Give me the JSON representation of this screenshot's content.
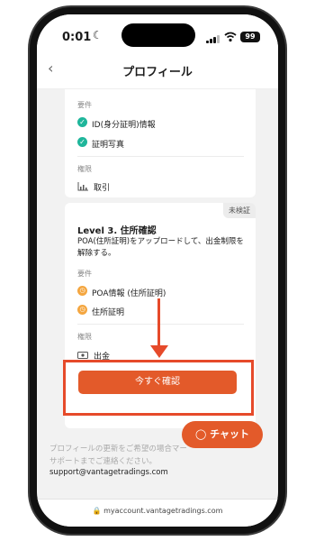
{
  "status": {
    "time": "0:01",
    "battery": "99"
  },
  "header": {
    "title": "プロフィール"
  },
  "level2": {
    "requirements_label": "要件",
    "requirements": [
      "ID(身分証明)情報",
      "証明写真"
    ],
    "permissions_label": "権限",
    "permission": "取引"
  },
  "level3": {
    "badge": "未検証",
    "title": "Level 3. 住所確認",
    "description": "POA(住所証明)をアップロードして、出金制限を解除する。",
    "requirements_label": "要件",
    "requirements": [
      "POA情報 (住所証明)",
      "住所証明"
    ],
    "permissions_label": "権限",
    "permission": "出金",
    "button_label": "今すぐ確認"
  },
  "footer": {
    "note": "プロフィールの更新をご希望の場合マーサポートまでご連絡ください。",
    "email": "support@vantagetradings.com",
    "chat_label": "チャット"
  },
  "browser": {
    "url": "myaccount.vantagetradings.com"
  },
  "colors": {
    "accent": "#e35a2a",
    "check": "#1fb69b",
    "pending": "#f4a640"
  }
}
